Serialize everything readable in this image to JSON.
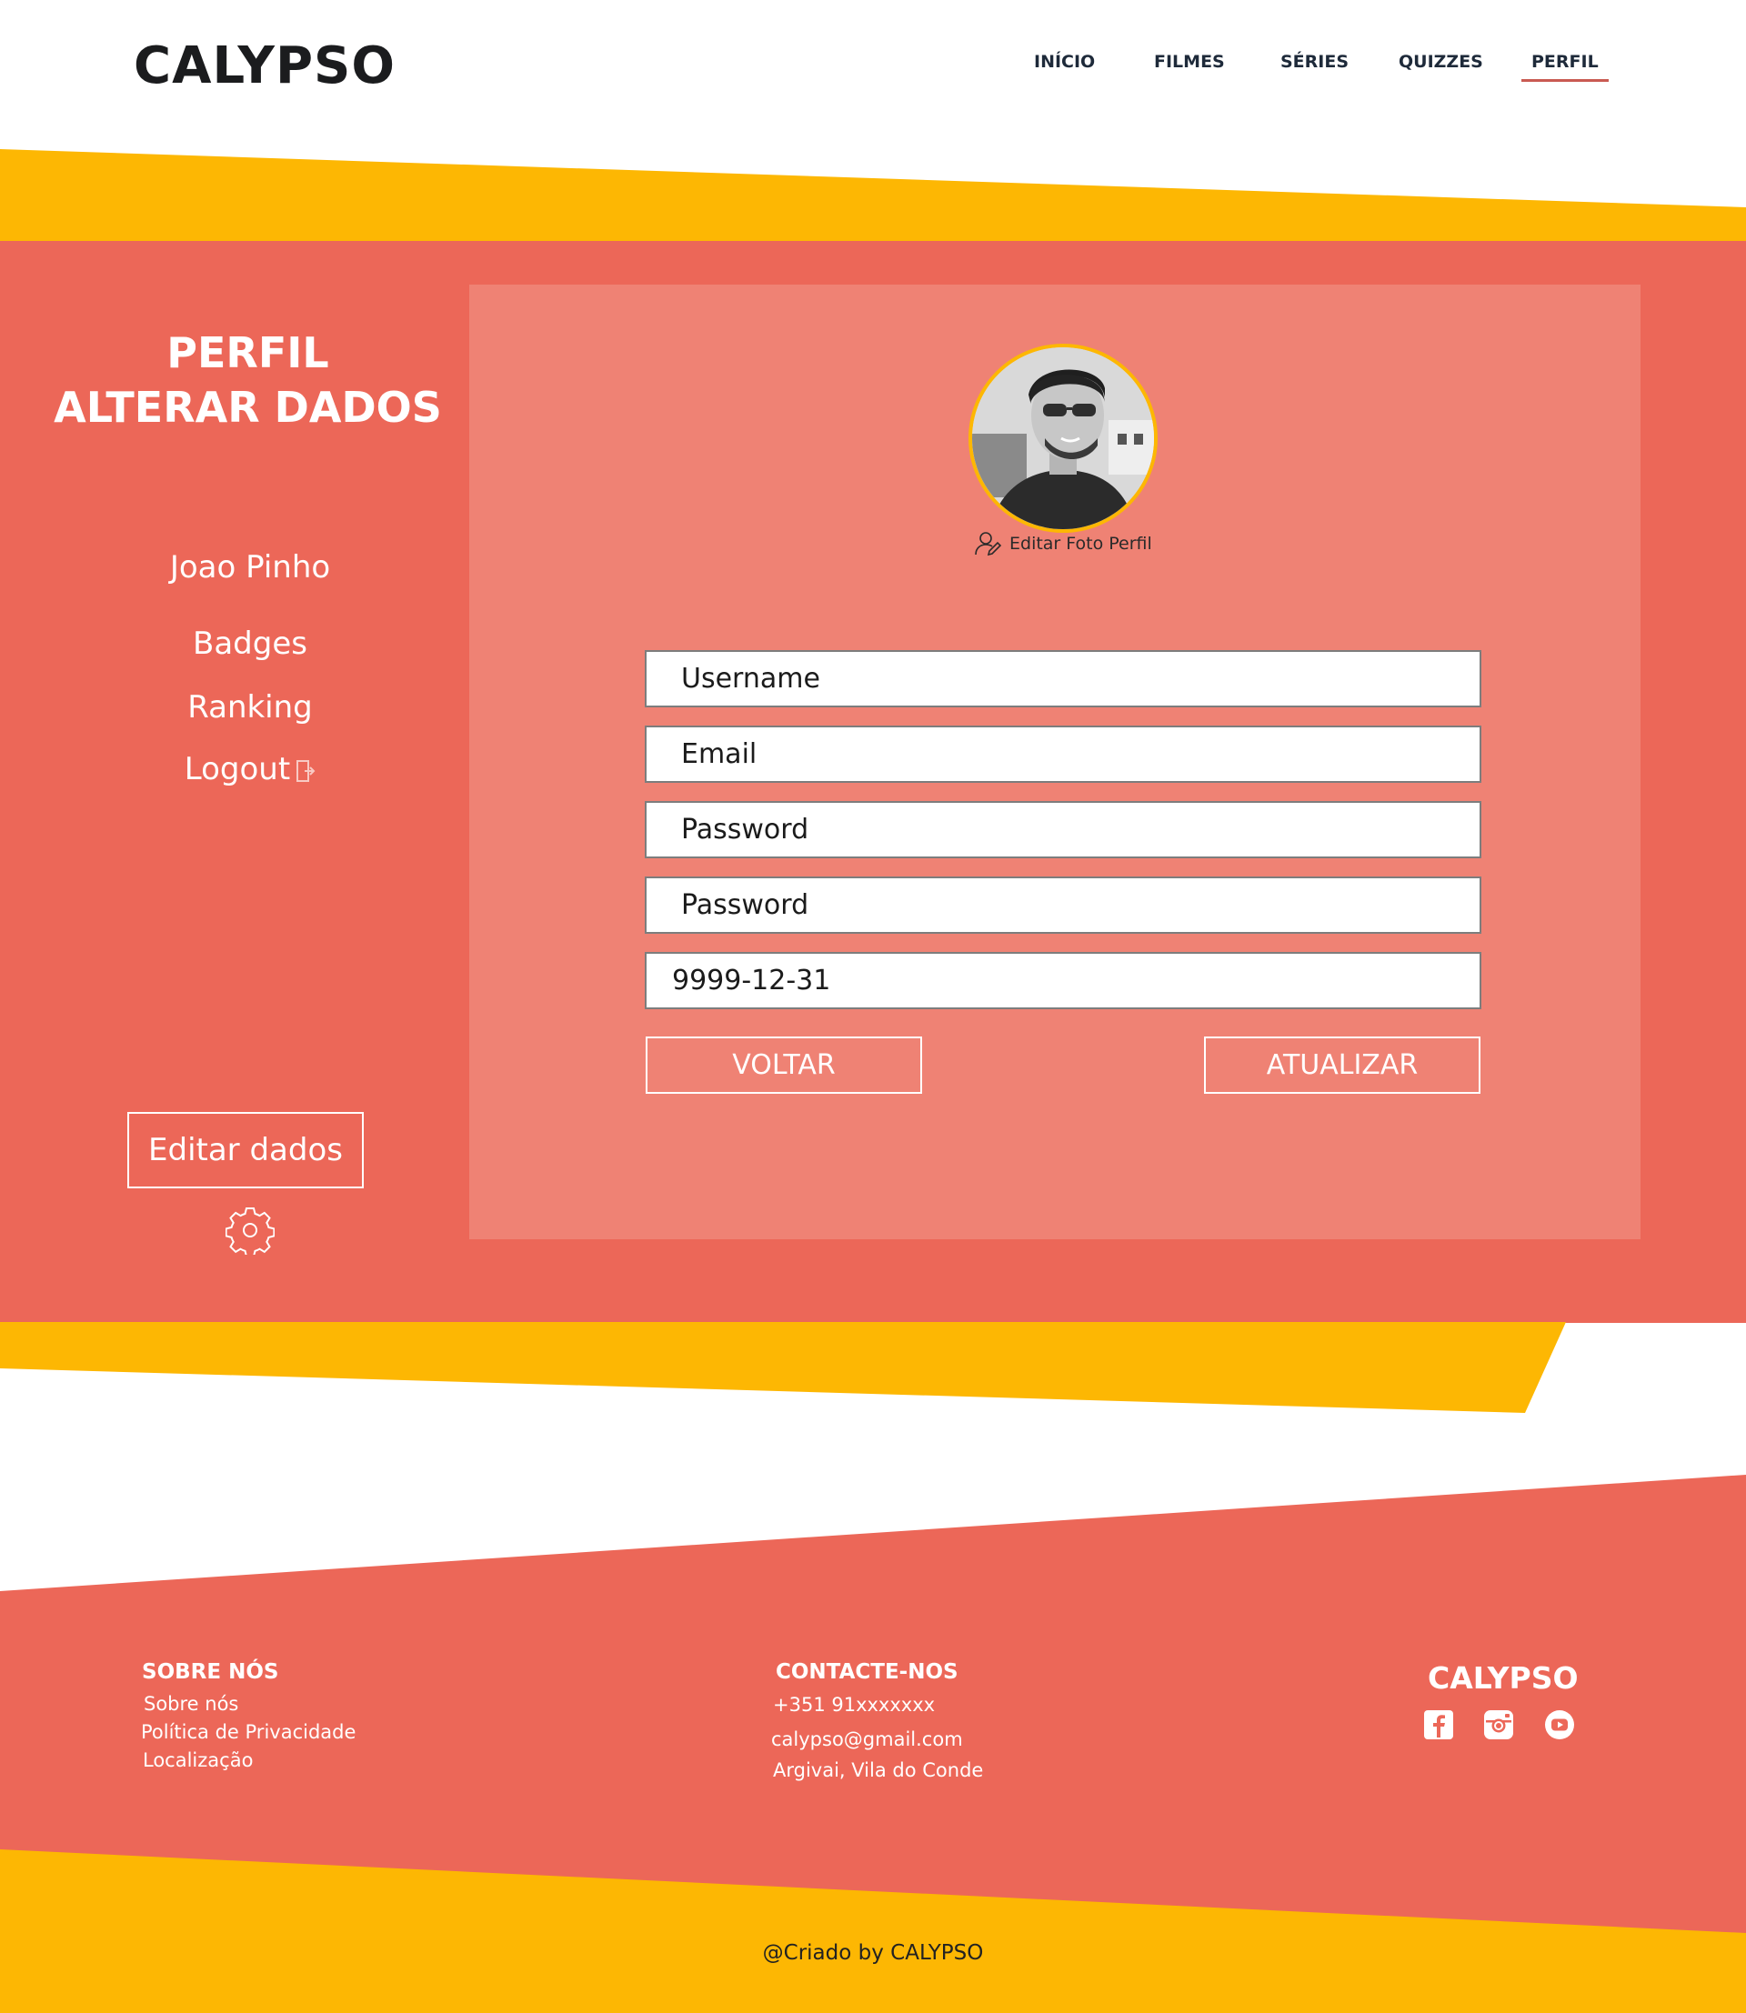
{
  "header": {
    "logo": "CALYPSO",
    "nav": [
      {
        "label": "INÍCIO"
      },
      {
        "label": "FILMES"
      },
      {
        "label": "SÉRIES"
      },
      {
        "label": "QUIZZES"
      },
      {
        "label": "PERFIL",
        "active": true
      }
    ]
  },
  "sidebar": {
    "title_line1": "PERFIL",
    "title_line2": "ALTERAR DADOS",
    "user_name": "Joao Pinho",
    "links": [
      {
        "label": "Badges"
      },
      {
        "label": "Ranking"
      },
      {
        "label": "Logout",
        "icon": "logout-icon"
      }
    ],
    "edit_button": "Editar dados",
    "settings_icon": "gear-icon"
  },
  "profile": {
    "avatar_icon": "profile-photo",
    "edit_photo_label": "Editar Foto Perfil",
    "edit_photo_icon": "user-edit-icon"
  },
  "form": {
    "username_placeholder": "Username",
    "email_placeholder": "Email",
    "password_placeholder": "Password",
    "password_confirm_placeholder": "Password",
    "birthdate_value": "9999-12-31",
    "back_button": "VOLTAR",
    "update_button": "ATUALIZAR"
  },
  "footer": {
    "about_heading": "SOBRE NÓS",
    "about_links": [
      "Sobre nós",
      "Política de Privacidade",
      "Localização"
    ],
    "contact_heading": "CONTACTE-NOS",
    "phone": "+351 91xxxxxxx",
    "email": "calypso@gmail.com",
    "address": "Argivai, Vila do Conde",
    "brand": "CALYPSO",
    "social": [
      "facebook-icon",
      "instagram-icon",
      "youtube-icon"
    ],
    "copyright": "@Criado by CALYPSO"
  },
  "colors": {
    "coral": "#ec6758",
    "panel": "#ef8274",
    "yellow": "#fdb703",
    "dark": "#1b1c1e"
  }
}
